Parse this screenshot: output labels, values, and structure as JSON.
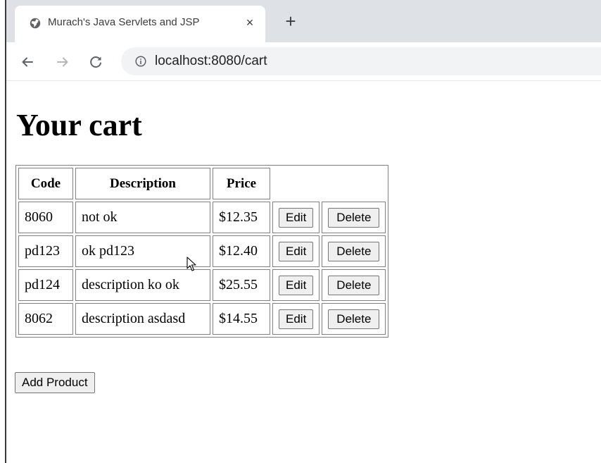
{
  "browser": {
    "tab_title": "Murach's Java Servlets and JSP",
    "tab_close": "×",
    "new_tab": "+",
    "url": "localhost:8080/cart",
    "icons": {
      "favicon": "globe-icon",
      "close": "close-icon",
      "new_tab": "plus-icon",
      "back": "arrow-left-icon",
      "forward": "arrow-right-icon",
      "reload": "reload-icon",
      "site_info": "info-icon"
    }
  },
  "page": {
    "title": "Your cart",
    "table": {
      "headers": [
        "Code",
        "Description",
        "Price"
      ],
      "rows": [
        {
          "code": "8060",
          "description": "not ok",
          "price": "$12.35",
          "edit": "Edit",
          "delete": "Delete"
        },
        {
          "code": "pd123",
          "description": "ok pd123",
          "price": "$12.40",
          "edit": "Edit",
          "delete": "Delete"
        },
        {
          "code": "pd124",
          "description": "description ko ok",
          "price": "$25.55",
          "edit": "Edit",
          "delete": "Delete"
        },
        {
          "code": "8062",
          "description": "description asdasd",
          "price": "$14.55",
          "edit": "Edit",
          "delete": "Delete"
        }
      ]
    },
    "add_button": "Add Product"
  },
  "colors": {
    "tabstrip_bg": "#dee1e6",
    "omnibox_bg": "#f1f3f4",
    "button_bg": "#efefef",
    "table_border": "#808080"
  }
}
